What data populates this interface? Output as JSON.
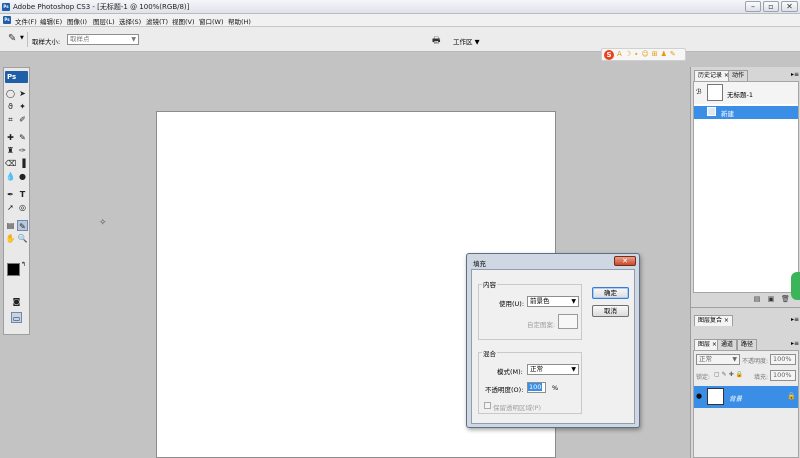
{
  "window": {
    "title": "Adobe Photoshop CS3 - [无标题-1 @ 100%(RGB/8)]",
    "app_icon": "Ps"
  },
  "menu": [
    "文件(F)",
    "编辑(E)",
    "图像(I)",
    "图层(L)",
    "选择(S)",
    "滤镜(T)",
    "视图(V)",
    "窗口(W)",
    "帮助(H)"
  ],
  "options_bar": {
    "sample_size_label": "取样大小:",
    "sample_size_value": "取样点",
    "workspace_label": "工作区"
  },
  "toolbox": {
    "logo": "Ps"
  },
  "dialog": {
    "title": "填充",
    "content_group": "内容",
    "use_label": "使用(U):",
    "use_value": "前景色",
    "custom_pattern_label": "自定图案:",
    "blend_group": "混合",
    "mode_label": "模式(M):",
    "mode_value": "正常",
    "opacity_label": "不透明度(O):",
    "opacity_value": "100",
    "opacity_unit": "%",
    "preserve_label": "保留透明区域(P)",
    "ok_label": "确定",
    "cancel_label": "取消"
  },
  "history_panel": {
    "tabs": [
      "历史记录",
      "动作"
    ],
    "snapshot_label": "无标题-1",
    "item_label": "新建"
  },
  "layer_comps_panel": {
    "tab": "图层复合"
  },
  "layers_panel": {
    "tabs": [
      "图层",
      "通道",
      "路径"
    ],
    "blend_mode": "正常",
    "opacity_label": "不透明度:",
    "opacity_value": "100%",
    "lock_label": "锁定:",
    "fill_label": "填充:",
    "fill_value": "100%",
    "layer_name": "背景"
  },
  "colors": {
    "accent": "#3a8ee6",
    "selected_row": "#3a8ee6",
    "workspace_bg": "#c3c3c3"
  }
}
